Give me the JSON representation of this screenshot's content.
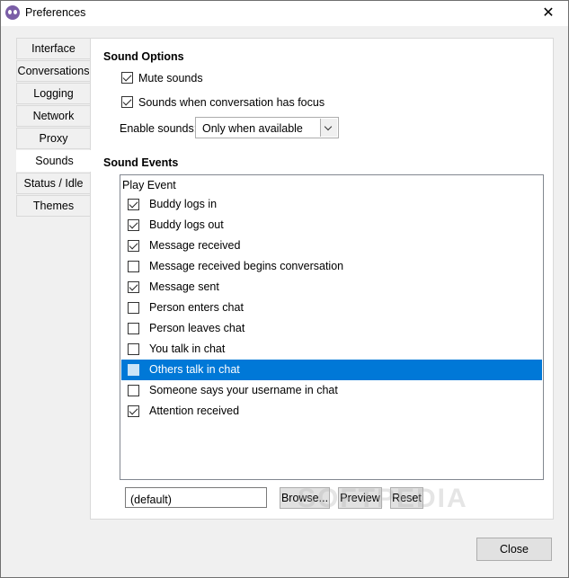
{
  "window": {
    "title": "Preferences"
  },
  "tabs": [
    {
      "label": "Interface"
    },
    {
      "label": "Conversations"
    },
    {
      "label": "Logging"
    },
    {
      "label": "Network"
    },
    {
      "label": "Proxy"
    },
    {
      "label": "Sounds",
      "active": true
    },
    {
      "label": "Status / Idle"
    },
    {
      "label": "Themes"
    }
  ],
  "sound_options": {
    "title": "Sound Options",
    "mute_label": "Mute sounds",
    "mute_checked": true,
    "focus_label": "Sounds when conversation has focus",
    "focus_checked": true,
    "enable_label": "Enable sounds:",
    "enable_value": "Only when available"
  },
  "sound_events": {
    "title": "Sound Events",
    "header": "Play Event",
    "rows": [
      {
        "label": "Buddy logs in",
        "checked": true
      },
      {
        "label": "Buddy logs out",
        "checked": true
      },
      {
        "label": "Message received",
        "checked": true
      },
      {
        "label": "Message received begins conversation",
        "checked": false
      },
      {
        "label": "Message sent",
        "checked": true
      },
      {
        "label": "Person enters chat",
        "checked": false
      },
      {
        "label": "Person leaves chat",
        "checked": false
      },
      {
        "label": "You talk in chat",
        "checked": false
      },
      {
        "label": "Others talk in chat",
        "checked": false,
        "selected": true
      },
      {
        "label": "Someone says your username in chat",
        "checked": false
      },
      {
        "label": "Attention received",
        "checked": true
      }
    ]
  },
  "file": {
    "value": "(default)",
    "browse_label": "Browse...",
    "preview_label": "Preview",
    "reset_label": "Reset"
  },
  "footer": {
    "close_label": "Close"
  },
  "watermark": "SOFTPEDIA"
}
